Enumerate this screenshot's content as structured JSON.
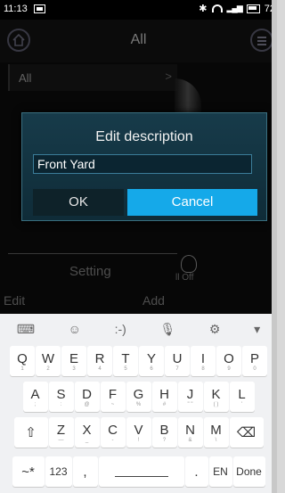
{
  "status_bar": {
    "time": "11:13",
    "battery_text": "72"
  },
  "header": {
    "title": "All"
  },
  "dropdown": {
    "label": "All",
    "arrow": ">"
  },
  "bottom": {
    "setting": "Setting",
    "edit": "Edit",
    "add": "Add",
    "all_off": "ll Off"
  },
  "dialog": {
    "title": "Edit description",
    "input_value": "Front Yard",
    "ok": "OK",
    "cancel": "Cancel"
  },
  "keyboard": {
    "toolbar": [
      "⌨",
      "☺",
      ":-)",
      "🎙",
      "⚙",
      "▾"
    ],
    "row1": [
      [
        "Q",
        "1"
      ],
      [
        "W",
        "2"
      ],
      [
        "E",
        "3"
      ],
      [
        "R",
        "4"
      ],
      [
        "T",
        "5"
      ],
      [
        "Y",
        "6"
      ],
      [
        "U",
        "7"
      ],
      [
        "I",
        "8"
      ],
      [
        "O",
        "9"
      ],
      [
        "P",
        "0"
      ]
    ],
    "row2": [
      [
        "A",
        ";"
      ],
      [
        "S",
        ":"
      ],
      [
        "D",
        "@"
      ],
      [
        "F",
        "~"
      ],
      [
        "G",
        "%"
      ],
      [
        "H",
        "#"
      ],
      [
        "J",
        "\" \""
      ],
      [
        "K",
        "( )"
      ],
      [
        "L",
        "'"
      ]
    ],
    "row3": [
      [
        "Z",
        "—"
      ],
      [
        "X",
        "_"
      ],
      [
        "C",
        "-"
      ],
      [
        "V",
        "!"
      ],
      [
        "B",
        "?"
      ],
      [
        "N",
        "&"
      ],
      [
        "M",
        "\\"
      ]
    ],
    "sym": "~*",
    "num": "123",
    "comma": ",",
    "dot": ".",
    "lang": "EN",
    "done": "Done",
    "shift": "⇧",
    "delete": "⌫"
  }
}
